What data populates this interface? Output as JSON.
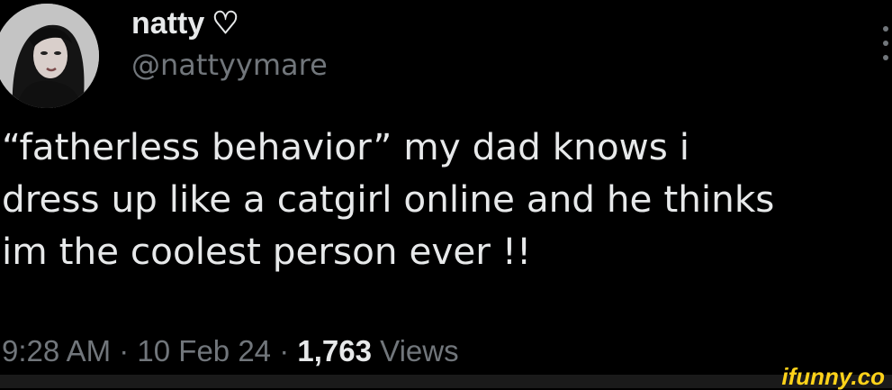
{
  "tweet": {
    "display_name": "natty",
    "name_emoji": "♡",
    "handle": "@nattyymare",
    "text_lines": [
      "“fatherless behavior” my dad knows i",
      "dress up like a catgirl online and he thinks",
      "im the coolest person ever !!"
    ],
    "time": "9:28 AM",
    "separator": "·",
    "date": "10 Feb 24",
    "views_count": "1,763",
    "views_label": "Views"
  },
  "watermark": {
    "text": "ifunny.co",
    "color": "#ffd31a"
  },
  "icons": {
    "more": "more-options-icon",
    "heart": "heart-outline-icon"
  },
  "colors": {
    "background": "#000000",
    "primary_text": "#e7e9ea",
    "secondary_text": "#71767b"
  }
}
